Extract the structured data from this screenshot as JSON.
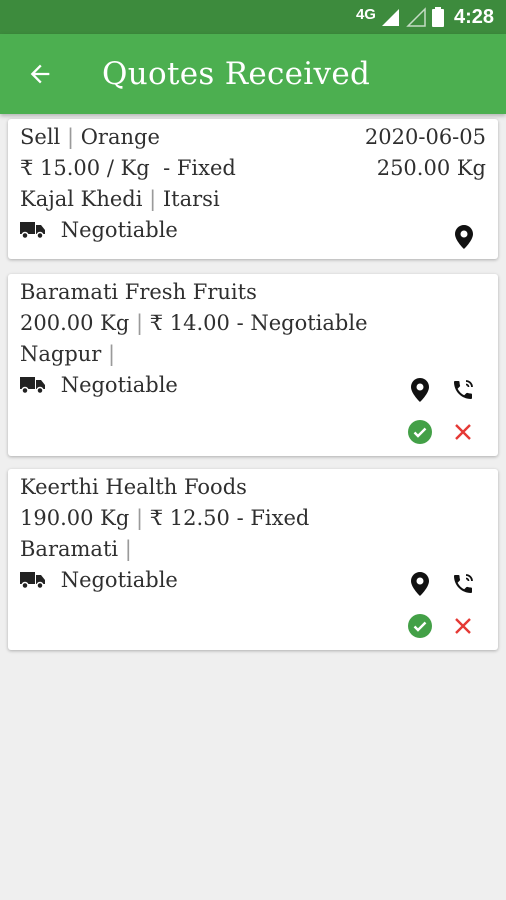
{
  "status_bar": {
    "network": "4G",
    "time": "4:28"
  },
  "app_bar": {
    "title": "Quotes Received"
  },
  "request": {
    "type": "Sell",
    "product": "Orange",
    "date": "2020-06-05",
    "price": "₹ 15.00 / Kg  - Fixed",
    "quantity": "250.00 Kg",
    "village": "Kajal Khedi",
    "city": "Itarsi",
    "transport": "Negotiable"
  },
  "quotes": [
    {
      "buyer": "Baramati Fresh Fruits",
      "quantity": "200.00 Kg",
      "price_terms": "₹ 14.00 - Negotiable",
      "location": "Nagpur",
      "transport": "Negotiable"
    },
    {
      "buyer": "Keerthi Health Foods",
      "quantity": "190.00 Kg",
      "price_terms": "₹ 12.50 - Fixed",
      "location": "Baramati",
      "transport": "Negotiable"
    }
  ],
  "colors": {
    "primary": "#4caf50",
    "status": "#3d8b3d",
    "accept": "#43a047",
    "reject": "#e53935"
  },
  "icons": [
    "arrow-back-icon",
    "truck-icon",
    "location-pin-icon",
    "phone-call-icon",
    "check-circle-icon",
    "close-icon"
  ]
}
